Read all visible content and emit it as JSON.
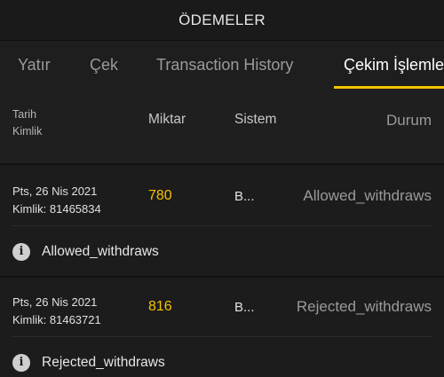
{
  "header": {
    "title": "ÖDEMELER"
  },
  "tabs": [
    {
      "label": "Yatır",
      "active": false
    },
    {
      "label": "Çek",
      "active": false
    },
    {
      "label": "Transaction History",
      "active": false
    },
    {
      "label": "Çekim İşlemleri",
      "active": true
    }
  ],
  "table": {
    "headers": {
      "date_line1": "Tarih",
      "date_line2": "Kimlik",
      "amount": "Miktar",
      "system": "Sistem",
      "status": "Durum"
    },
    "rows": [
      {
        "date": "Pts, 26 Nis 2021",
        "id": "Kimlik: 81465834",
        "amount": "780",
        "system": "B...",
        "status": "Allowed_withdraws",
        "info": "Allowed_withdraws"
      },
      {
        "date": "Pts, 26 Nis 2021",
        "id": "Kimlik: 81463721",
        "amount": "816",
        "system": "B...",
        "status": "Rejected_withdraws",
        "info": "Rejected_withdraws"
      }
    ]
  },
  "colors": {
    "accent": "#f5c400",
    "background": "#1c1c1c"
  },
  "icons": {
    "info": "info-icon"
  }
}
